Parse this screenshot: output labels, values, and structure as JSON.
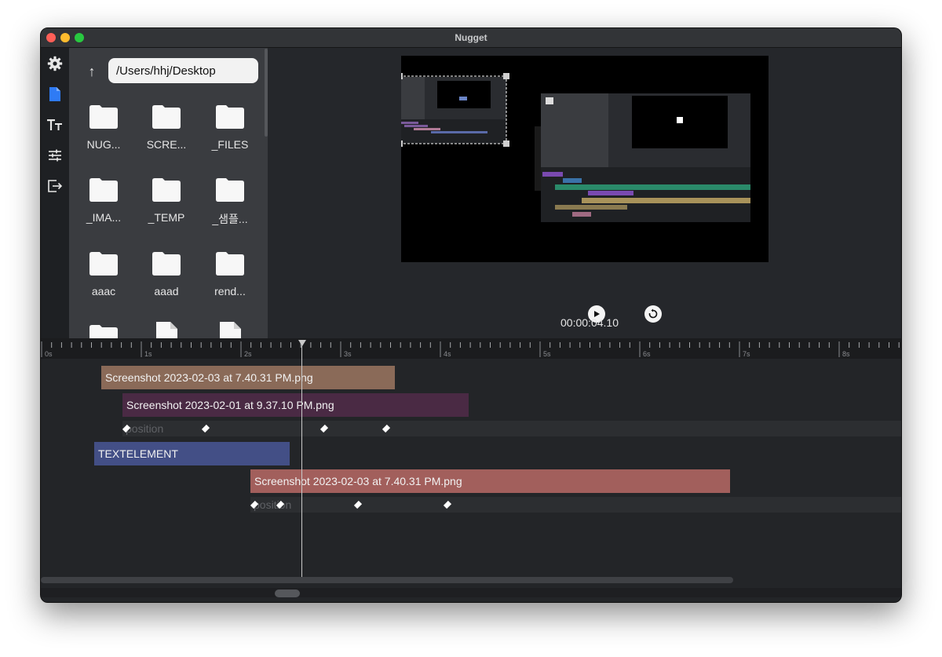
{
  "window": {
    "title": "Nugget"
  },
  "sidebar": {
    "icons": [
      "gear-icon",
      "document-icon",
      "text-icon",
      "sliders-icon",
      "export-icon"
    ],
    "active": "document-icon"
  },
  "file_browser": {
    "path": "/Users/hhj/Desktop",
    "items": [
      {
        "label": "NUG...",
        "kind": "folder"
      },
      {
        "label": "SCRE...",
        "kind": "folder"
      },
      {
        "label": "_FILES",
        "kind": "folder"
      },
      {
        "label": "_IMA...",
        "kind": "folder"
      },
      {
        "label": "_TEMP",
        "kind": "folder"
      },
      {
        "label": "_샘플...",
        "kind": "folder"
      },
      {
        "label": "aaac",
        "kind": "folder"
      },
      {
        "label": "aaad",
        "kind": "folder"
      },
      {
        "label": "rend...",
        "kind": "folder"
      },
      {
        "label": "",
        "kind": "folder"
      },
      {
        "label": "",
        "kind": "file"
      },
      {
        "label": "",
        "kind": "file"
      }
    ]
  },
  "preview": {
    "timecode": "00:00:04.10"
  },
  "timeline": {
    "ruler_labels": [
      "0s",
      "1s",
      "2s",
      "3s",
      "4s",
      "5s",
      "6s",
      "7s",
      "8s"
    ],
    "clips": [
      {
        "label": "Screenshot 2023-02-03 at 7.40.31 PM.png",
        "color": "#8a6a58"
      },
      {
        "label": "Screenshot 2023-02-01 at 9.37.10 PM.png",
        "color": "#4a2a44"
      },
      {
        "label": "TEXTELEMENT",
        "color": "#434f86"
      },
      {
        "label": "Screenshot 2023-02-03 at 7.40.31 PM.png",
        "color": "#a25f5c"
      }
    ],
    "property_rows": [
      {
        "label": "position"
      },
      {
        "label": "position"
      }
    ],
    "playhead_seconds": 2.6
  }
}
